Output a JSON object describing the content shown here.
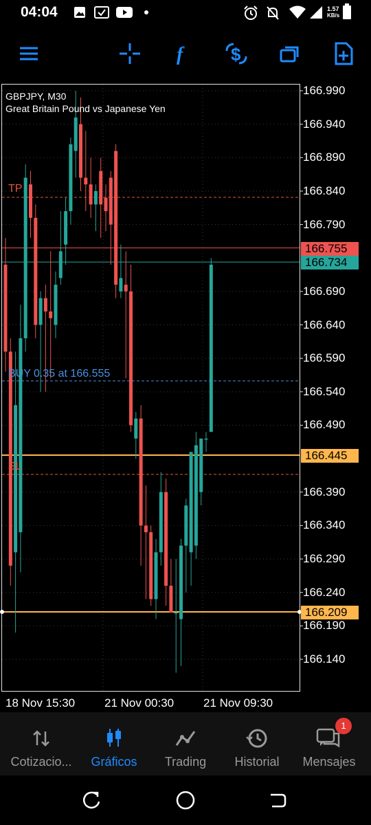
{
  "status": {
    "time": "04:04",
    "speed_value": "1.57",
    "speed_unit": "KB/s"
  },
  "toolbar": {
    "icons": [
      "menu-icon",
      "crosshair-icon",
      "function-icon",
      "dollar-exchange-icon",
      "windows-icon",
      "new-order-icon"
    ]
  },
  "chart": {
    "symbol": "GBPJPY, M30",
    "description": "Great Britain Pound vs Japanese Yen",
    "y_ticks": [
      "166.990",
      "166.940",
      "166.890",
      "166.840",
      "166.790",
      "166.690",
      "166.640",
      "166.590",
      "166.540",
      "166.490",
      "166.390",
      "166.340",
      "166.290",
      "166.240",
      "166.190",
      "166.140"
    ],
    "x_ticks": [
      "18 Nov 15:30",
      "21 Nov 00:30",
      "21 Nov 09:30"
    ],
    "price_tags": {
      "ask": "166.755",
      "bid": "166.734",
      "line_high": "166.445",
      "line_low": "166.209"
    },
    "order_labels": {
      "tp": "TP",
      "buy": "BUY 0.35 at 166.555",
      "sl": "SL"
    },
    "colors": {
      "bull": "#26a69a",
      "bear": "#ef5350",
      "level": "#ffb74d",
      "buy": "#4a90e2",
      "tp_sl": "#e0573a"
    }
  },
  "chart_data": {
    "type": "candlestick",
    "symbol": "GBPJPY",
    "timeframe": "M30",
    "ylim": [
      166.1,
      167.0
    ],
    "candles": [
      [
        166.73,
        166.77,
        166.57,
        166.6
      ],
      [
        166.6,
        166.62,
        166.25,
        166.28
      ],
      [
        166.3,
        166.6,
        166.18,
        166.52
      ],
      [
        166.33,
        166.67,
        166.27,
        166.62
      ],
      [
        166.62,
        166.88,
        166.6,
        166.86
      ],
      [
        166.85,
        166.87,
        166.77,
        166.8
      ],
      [
        166.8,
        166.82,
        166.62,
        166.64
      ],
      [
        166.64,
        166.69,
        166.54,
        166.68
      ],
      [
        166.68,
        166.7,
        166.54,
        166.66
      ],
      [
        166.66,
        166.75,
        166.56,
        166.65
      ],
      [
        166.64,
        166.72,
        166.62,
        166.7
      ],
      [
        166.71,
        166.81,
        166.7,
        166.75
      ],
      [
        166.76,
        166.83,
        166.73,
        166.81
      ],
      [
        166.81,
        166.92,
        166.79,
        166.91
      ],
      [
        166.9,
        166.99,
        166.86,
        166.95
      ],
      [
        166.94,
        166.98,
        166.84,
        166.86
      ],
      [
        166.86,
        166.93,
        166.81,
        166.85
      ],
      [
        166.85,
        166.89,
        166.8,
        166.82
      ],
      [
        166.82,
        166.85,
        166.78,
        166.84
      ],
      [
        166.87,
        166.89,
        166.77,
        166.82
      ],
      [
        166.83,
        166.85,
        166.78,
        166.81
      ],
      [
        166.86,
        166.87,
        166.73,
        166.79
      ],
      [
        166.9,
        166.91,
        166.68,
        166.7
      ],
      [
        166.69,
        166.76,
        166.68,
        166.71
      ],
      [
        166.7,
        166.75,
        166.56,
        166.69
      ],
      [
        166.69,
        166.73,
        166.48,
        166.49
      ],
      [
        166.47,
        166.51,
        166.44,
        166.5
      ],
      [
        166.5,
        166.52,
        166.28,
        166.34
      ],
      [
        166.34,
        166.4,
        166.23,
        166.33
      ],
      [
        166.33,
        166.34,
        166.22,
        166.23
      ],
      [
        166.23,
        166.32,
        166.2,
        166.3
      ],
      [
        166.3,
        166.42,
        166.28,
        166.39
      ],
      [
        166.39,
        166.41,
        166.22,
        166.25
      ],
      [
        166.25,
        166.29,
        166.21,
        166.21
      ],
      [
        166.21,
        166.29,
        166.12,
        166.21
      ],
      [
        166.2,
        166.32,
        166.13,
        166.31
      ],
      [
        166.31,
        166.38,
        166.24,
        166.37
      ],
      [
        166.3,
        166.44,
        166.25,
        166.45
      ],
      [
        166.31,
        166.48,
        166.29,
        166.46
      ],
      [
        166.39,
        166.47,
        166.37,
        166.47
      ],
      [
        166.47,
        166.48,
        166.45,
        166.47
      ],
      [
        166.48,
        166.74,
        166.48,
        166.73
      ]
    ]
  },
  "nav": {
    "items": [
      {
        "label": "Cotizacio...",
        "icon": "quotes-arrows-icon",
        "active": false
      },
      {
        "label": "Gráficos",
        "icon": "candles-chart-icon",
        "active": true
      },
      {
        "label": "Trading",
        "icon": "trading-line-icon",
        "active": false
      },
      {
        "label": "Historial",
        "icon": "history-clock-icon",
        "active": false
      },
      {
        "label": "Mensajes",
        "icon": "messages-icon",
        "active": false
      }
    ],
    "badge": "1"
  },
  "system_nav": {
    "icons": [
      "recents-icon",
      "home-icon",
      "back-icon"
    ]
  }
}
